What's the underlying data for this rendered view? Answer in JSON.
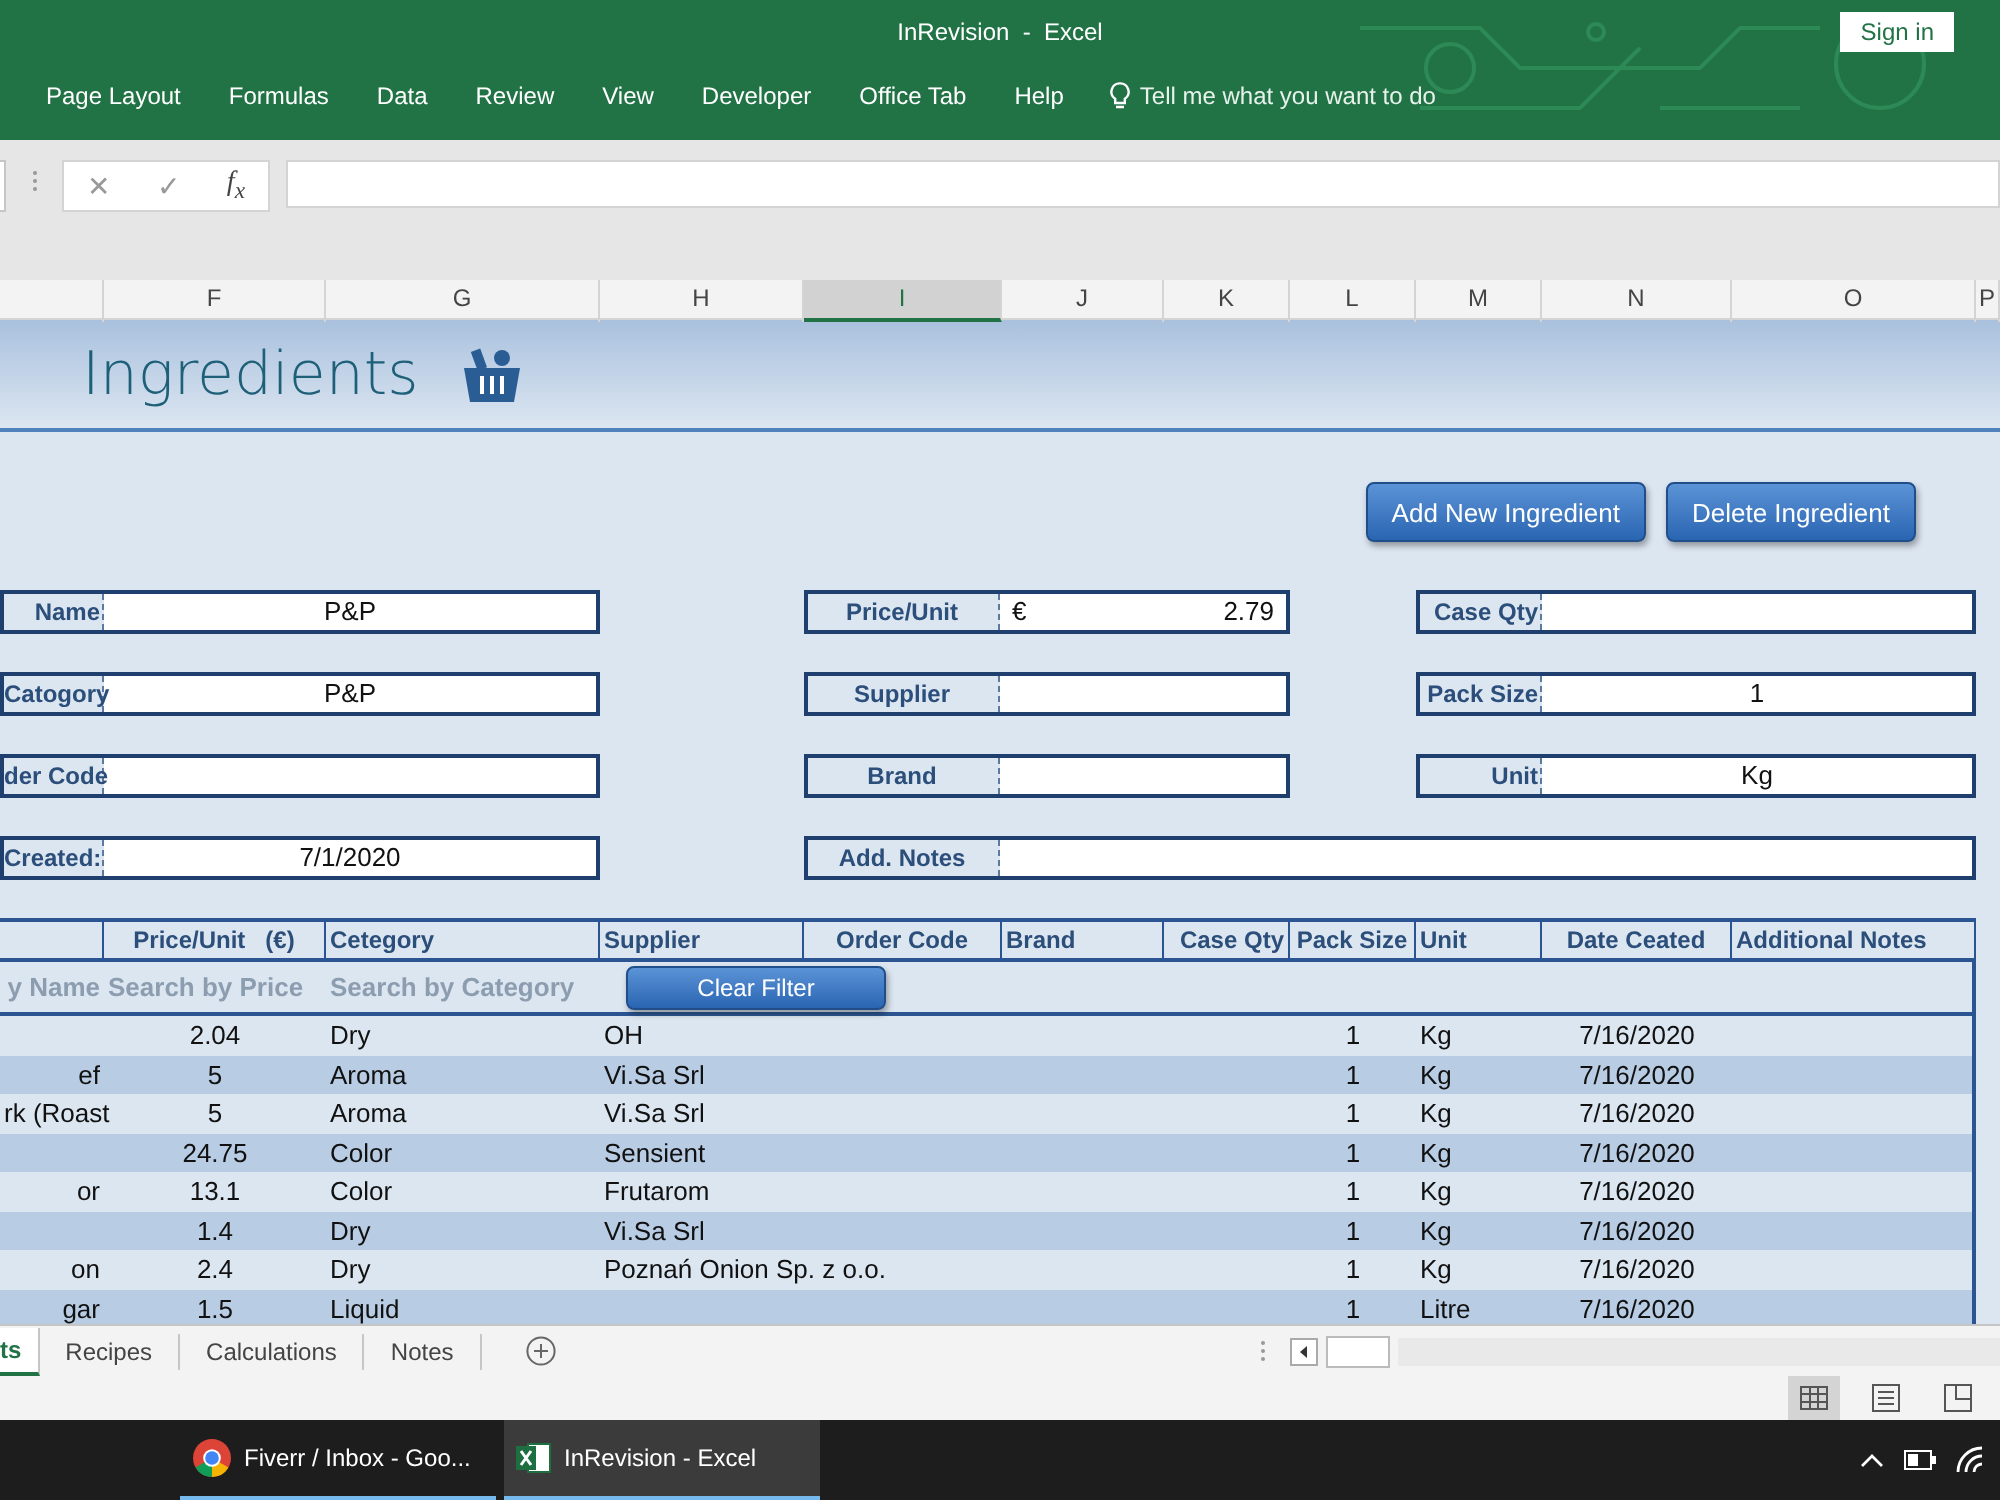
{
  "window": {
    "title": "InRevision  -  Excel",
    "sign_in": "Sign in"
  },
  "ribbon_tabs": [
    "Page Layout",
    "Formulas",
    "Data",
    "Review",
    "View",
    "Developer",
    "Office Tab",
    "Help"
  ],
  "tell_me": "Tell me what you want to do",
  "formula_bar": {
    "cancel": "✕",
    "enter": "✓",
    "function": "f$_{x}$"
  },
  "column_headers": [
    {
      "label": "F",
      "selected": false
    },
    {
      "label": "G",
      "selected": false
    },
    {
      "label": "H",
      "selected": false
    },
    {
      "label": "I",
      "selected": true
    },
    {
      "label": "J",
      "selected": false
    },
    {
      "label": "K",
      "selected": false
    },
    {
      "label": "L",
      "selected": false
    },
    {
      "label": "M",
      "selected": false
    },
    {
      "label": "N",
      "selected": false
    },
    {
      "label": "O",
      "selected": false
    },
    {
      "label": "P",
      "selected": false
    }
  ],
  "sheet": {
    "title": "Ingredients",
    "buttons": [
      "Add New Ingredient",
      "Delete Ingredient"
    ],
    "form_rows": [
      {
        "left": {
          "label": "Name",
          "value": "P&P"
        },
        "middle": {
          "label": "Price/Unit",
          "prefix": "€",
          "value": "2.79"
        },
        "right": {
          "label": "Case Qty"
        }
      },
      {
        "left": {
          "label": "Catogory",
          "value": "P&P"
        },
        "middle": {
          "label": "Supplier"
        },
        "right": {
          "label": "Pack Size",
          "value": "1"
        }
      },
      {
        "left": {
          "label": "der Code"
        },
        "middle": {
          "label": "Brand"
        },
        "right": {
          "label": "Unit",
          "value": "Kg"
        }
      },
      {
        "left": {
          "label": "Created:",
          "value": "7/1/2020"
        },
        "middle": {
          "label": "Add. Notes"
        }
      }
    ],
    "table": {
      "columns": [
        "Price/Unit   (€)",
        "Cetegory",
        "Supplier",
        "Order Code",
        "Brand",
        "Case Qty",
        "Pack Size",
        "Unit",
        "Date Ceated",
        "Additional Notes"
      ],
      "filters": [
        {
          "placeholder": "y Name"
        },
        {
          "placeholder": "Search by Price"
        },
        {
          "placeholder": "Search by Category"
        }
      ],
      "clear_filter": "Clear Filter",
      "rows": [
        {
          "price": "2.04",
          "category": "Dry",
          "supplier": "OH",
          "pack_size": "1",
          "unit": "Kg",
          "date": "7/16/2020"
        },
        {
          "name": "ef",
          "price": "5",
          "category": "Aroma",
          "supplier": "Vi.Sa Srl",
          "pack_size": "1",
          "unit": "Kg",
          "date": "7/16/2020"
        },
        {
          "name": "rk (Roast",
          "price": "5",
          "category": "Aroma",
          "supplier": "Vi.Sa Srl",
          "pack_size": "1",
          "unit": "Kg",
          "date": "7/16/2020"
        },
        {
          "price": "24.75",
          "category": "Color",
          "supplier": "Sensient",
          "pack_size": "1",
          "unit": "Kg",
          "date": "7/16/2020"
        },
        {
          "name": "or",
          "price": "13.1",
          "category": "Color",
          "supplier": "Frutarom",
          "pack_size": "1",
          "unit": "Kg",
          "date": "7/16/2020"
        },
        {
          "price": "1.4",
          "category": "Dry",
          "supplier": "Vi.Sa Srl",
          "pack_size": "1",
          "unit": "Kg",
          "date": "7/16/2020"
        },
        {
          "name": "on",
          "price": "2.4",
          "category": "Dry",
          "supplier": "Poznań Onion Sp. z o.o.",
          "pack_size": "1",
          "unit": "Kg",
          "date": "7/16/2020"
        },
        {
          "name": "gar",
          "price": "1.5",
          "category": "Liquid",
          "pack_size": "1",
          "unit": "Litre",
          "date": "7/16/2020"
        }
      ]
    }
  },
  "sheet_tabs": [
    {
      "label": "ts",
      "selected": true
    },
    {
      "label": "Recipes",
      "selected": false
    },
    {
      "label": "Calculations",
      "selected": false
    },
    {
      "label": "Notes",
      "selected": false
    }
  ],
  "view_buttons": [
    {
      "kind": "normal",
      "selected": true
    },
    {
      "kind": "page-layout",
      "selected": false
    },
    {
      "kind": "page-break",
      "selected": false
    }
  ],
  "taskbar": [
    {
      "kind": "chrome",
      "label": "Fiverr / Inbox - Goo...",
      "selected": false
    },
    {
      "kind": "excel",
      "label": "InRevision - Excel",
      "selected": true
    }
  ]
}
